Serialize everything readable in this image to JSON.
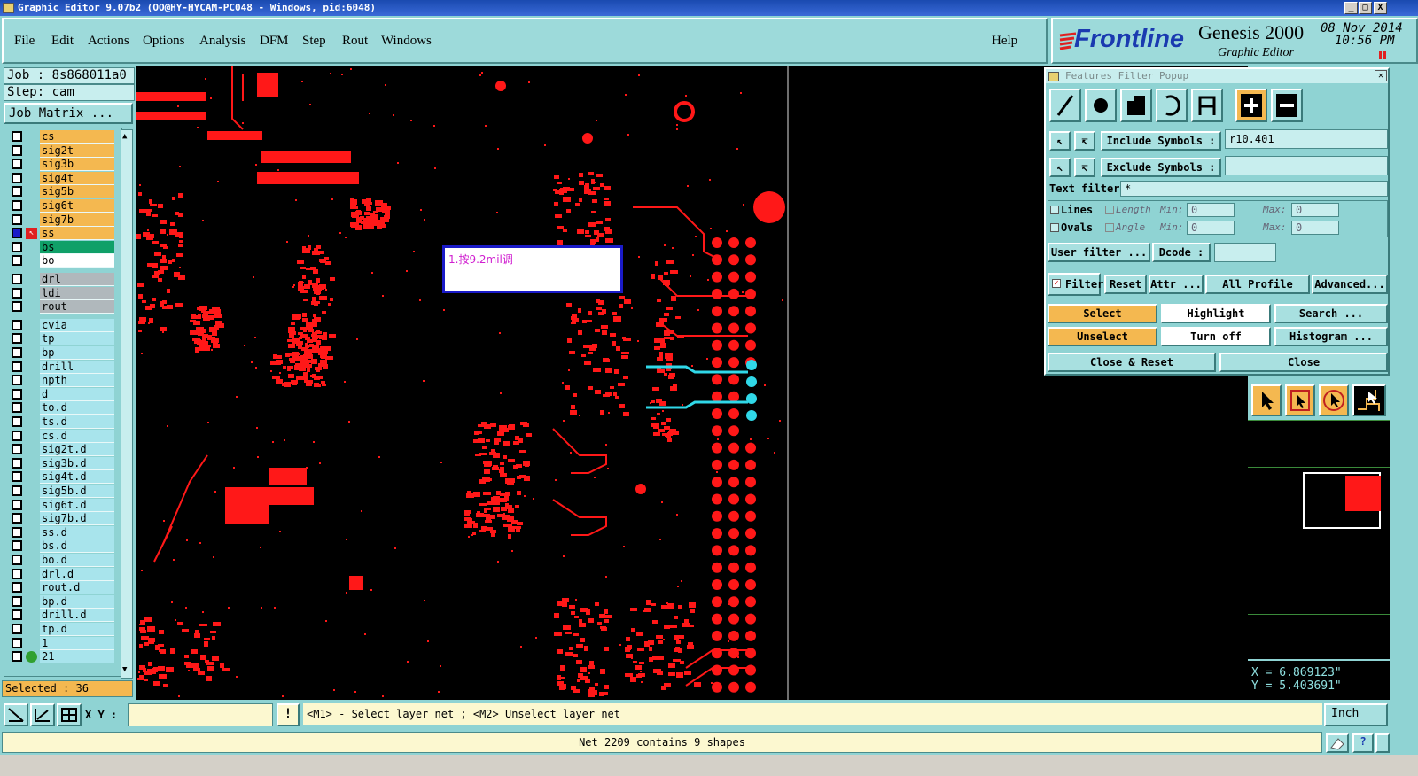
{
  "window": {
    "title": "Graphic Editor 9.07b2 (OO@HY-HYCAM-PC048 - Windows, pid:6048)",
    "min": "_",
    "max": "□",
    "close": "X"
  },
  "menu": {
    "file": "File",
    "edit": "Edit",
    "actions": "Actions",
    "options": "Options",
    "analysis": "Analysis",
    "dfm": "DFM",
    "step": "Step",
    "rout": "Rout",
    "windows": "Windows",
    "help": "Help"
  },
  "logo": {
    "brand": "Frontline",
    "product": "Genesis 2000",
    "subtitle": "Graphic Editor",
    "date": "08 Nov 2014",
    "time": "10:56 PM"
  },
  "job": {
    "job_line": "Job : 8s868011a0",
    "step_line": "Step: cam",
    "matrix_button": "Job Matrix ..."
  },
  "layers": [
    {
      "name": "cs",
      "style": "orange"
    },
    {
      "name": "sig2t",
      "style": "orange"
    },
    {
      "name": "sig3b",
      "style": "orange"
    },
    {
      "name": "sig4t",
      "style": "orange"
    },
    {
      "name": "sig5b",
      "style": "orange"
    },
    {
      "name": "sig6t",
      "style": "orange"
    },
    {
      "name": "sig7b",
      "style": "orange"
    },
    {
      "name": "ss",
      "style": "orange"
    },
    {
      "name": "bs",
      "style": "green"
    },
    {
      "name": "bo",
      "style": "white"
    },
    {
      "name": "drl",
      "style": "gray"
    },
    {
      "name": "ldi",
      "style": "gray"
    },
    {
      "name": "rout",
      "style": "gray"
    },
    {
      "name": "cvia",
      "style": "cyan"
    },
    {
      "name": "tp",
      "style": "cyan"
    },
    {
      "name": "bp",
      "style": "cyan"
    },
    {
      "name": "drill",
      "style": "cyan"
    },
    {
      "name": "npth",
      "style": "cyan"
    },
    {
      "name": "d",
      "style": "cyan"
    },
    {
      "name": "to.d",
      "style": "cyan"
    },
    {
      "name": "ts.d",
      "style": "cyan"
    },
    {
      "name": "cs.d",
      "style": "cyan"
    },
    {
      "name": "sig2t.d",
      "style": "cyan"
    },
    {
      "name": "sig3b.d",
      "style": "cyan"
    },
    {
      "name": "sig4t.d",
      "style": "cyan"
    },
    {
      "name": "sig5b.d",
      "style": "cyan"
    },
    {
      "name": "sig6t.d",
      "style": "cyan"
    },
    {
      "name": "sig7b.d",
      "style": "cyan"
    },
    {
      "name": "ss.d",
      "style": "cyan"
    },
    {
      "name": "bs.d",
      "style": "cyan"
    },
    {
      "name": "bo.d",
      "style": "cyan"
    },
    {
      "name": "drl.d",
      "style": "cyan"
    },
    {
      "name": "rout.d",
      "style": "cyan"
    },
    {
      "name": "bp.d",
      "style": "cyan"
    },
    {
      "name": "drill.d",
      "style": "cyan"
    },
    {
      "name": "tp.d",
      "style": "cyan"
    },
    {
      "name": "1",
      "style": "cyan"
    },
    {
      "name": "21",
      "style": "cyan"
    }
  ],
  "selected_count": "Selected : 36",
  "canvas": {
    "annotation": "1.按9.2mil调"
  },
  "filter_popup": {
    "title": "Features Filter Popup",
    "include_symbols_label": "Include Symbols :",
    "include_symbols_value": "r10.401",
    "exclude_symbols_label": "Exclude Symbols :",
    "exclude_symbols_value": "",
    "text_filter_label": "Text filter",
    "text_filter_value": "*",
    "lines_label": "Lines",
    "ovals_label": "Ovals",
    "length_label": "Length",
    "angle_label": "Angle",
    "min_label": "Min:",
    "max_label": "Max:",
    "length_min": "0",
    "length_max": "0",
    "angle_min": "0",
    "angle_max": "0",
    "user_filter": "User filter ...",
    "dcode_label": "Dcode :",
    "dcode_value": "",
    "filter": "Filter",
    "reset": "Reset",
    "attr": "Attr ...",
    "all_profile": "All Profile",
    "advanced": "Advanced...",
    "select": "Select",
    "highlight": "Highlight",
    "search": "Search ...",
    "unselect": "Unselect",
    "turn_off": "Turn off",
    "histogram": "Histogram ...",
    "close_reset": "Close & Reset",
    "close": "Close"
  },
  "coords": {
    "x": "X = 6.869123\"",
    "y": "Y = 5.403691\""
  },
  "cmd": {
    "xy_label": "X Y :",
    "xy_value": "",
    "message": "<M1> - Select layer net ; <M2> Unselect layer net",
    "units": "Inch"
  },
  "status": {
    "text": "Net 2209 contains 9 shapes"
  }
}
